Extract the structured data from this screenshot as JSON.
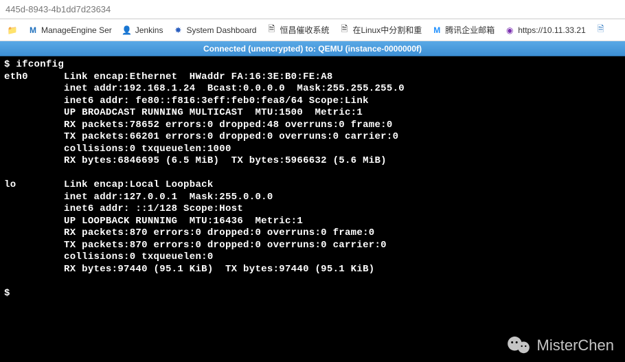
{
  "browser": {
    "url_fragment": "445d-8943-4b1dd7d23634",
    "bookmarks": [
      {
        "icon": "manage-engine-icon",
        "label": "ManageEngine Ser"
      },
      {
        "icon": "jenkins-icon",
        "label": "Jenkins"
      },
      {
        "icon": "system-dashboard-icon",
        "label": "System Dashboard"
      },
      {
        "icon": "page-icon",
        "label": "恒昌催收系统"
      },
      {
        "icon": "page-icon",
        "label": "在Linux中分割和重"
      },
      {
        "icon": "tencent-mail-icon",
        "label": "腾讯企业邮箱"
      },
      {
        "icon": "globe-icon",
        "label": "https://10.11.33.21"
      }
    ]
  },
  "connection_status": "Connected (unencrypted) to: QEMU (instance-0000000f)",
  "terminal": {
    "prompt1": "$ ",
    "cmd1": "ifconfig",
    "eth0": {
      "name": "eth0",
      "l1": "Link encap:Ethernet  HWaddr FA:16:3E:B0:FE:A8",
      "l2": "inet addr:192.168.1.24  Bcast:0.0.0.0  Mask:255.255.255.0",
      "l3": "inet6 addr: fe80::f816:3eff:feb0:fea8/64 Scope:Link",
      "l4": "UP BROADCAST RUNNING MULTICAST  MTU:1500  Metric:1",
      "l5": "RX packets:78652 errors:0 dropped:48 overruns:0 frame:0",
      "l6": "TX packets:66201 errors:0 dropped:0 overruns:0 carrier:0",
      "l7": "collisions:0 txqueuelen:1000",
      "l8": "RX bytes:6846695 (6.5 MiB)  TX bytes:5966632 (5.6 MiB)"
    },
    "lo": {
      "name": "lo",
      "l1": "Link encap:Local Loopback",
      "l2": "inet addr:127.0.0.1  Mask:255.0.0.0",
      "l3": "inet6 addr: ::1/128 Scope:Host",
      "l4": "UP LOOPBACK RUNNING  MTU:16436  Metric:1",
      "l5": "RX packets:870 errors:0 dropped:0 overruns:0 frame:0",
      "l6": "TX packets:870 errors:0 dropped:0 overruns:0 carrier:0",
      "l7": "collisions:0 txqueuelen:0",
      "l8": "RX bytes:97440 (95.1 KiB)  TX bytes:97440 (95.1 KiB)"
    },
    "prompt2": "$"
  },
  "watermark": {
    "text": "MisterChen"
  }
}
